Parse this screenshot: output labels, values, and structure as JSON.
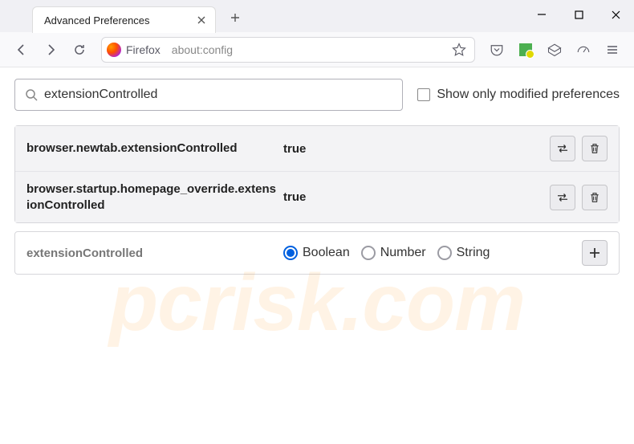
{
  "tab": {
    "title": "Advanced Preferences"
  },
  "addressbar": {
    "prefix": "Firefox",
    "url": "about:config"
  },
  "search": {
    "query": "extensionControlled",
    "checkbox_label": "Show only modified preferences"
  },
  "prefs": [
    {
      "name": "browser.newtab.extensionControlled",
      "value": "true"
    },
    {
      "name": "browser.startup.homepage_override.extensionControlled",
      "value": "true"
    }
  ],
  "new_pref": {
    "name": "extensionControlled",
    "types": [
      "Boolean",
      "Number",
      "String"
    ],
    "selected_type": "Boolean"
  },
  "watermark": "pcrisk.com"
}
